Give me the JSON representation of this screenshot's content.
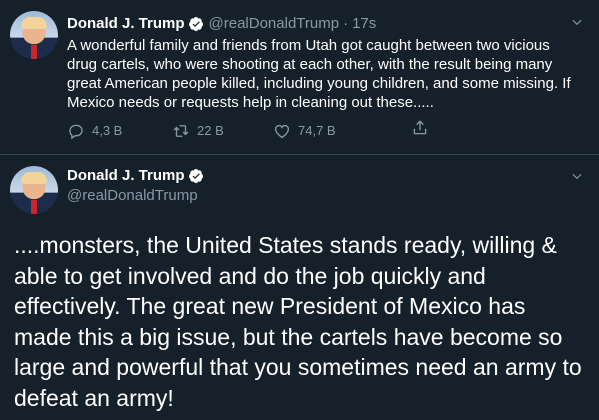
{
  "tweet1": {
    "display_name": "Donald J. Trump",
    "handle": "@realDonaldTrump",
    "separator": "·",
    "time": "17s",
    "text": "A wonderful family and friends from Utah got caught between two vicious drug cartels, who were shooting at each other, with the result being many great American people killed, including young children, and some missing. If Mexico needs or requests help in cleaning out these.....",
    "actions": {
      "reply_count": "4,3 В",
      "retweet_count": "22 В",
      "like_count": "74,7 В"
    }
  },
  "tweet2": {
    "display_name": "Donald J. Trump",
    "handle": "@realDonaldTrump",
    "text": "....monsters, the United States stands ready, willing & able to get involved and do the job quickly and effectively. The great new President of Mexico has made this a big issue, but the cartels have become so large and powerful that you sometimes need an army to defeat an army!"
  },
  "icons": {
    "verified": "verified-badge-icon",
    "caret": "chevron-down-icon",
    "reply": "reply-icon",
    "retweet": "retweet-icon",
    "like": "heart-icon",
    "share": "share-icon"
  },
  "colors": {
    "background": "#15202b",
    "divider": "#38444d",
    "muted_text": "#8899a6",
    "verified_blue": "#1da1f2"
  }
}
